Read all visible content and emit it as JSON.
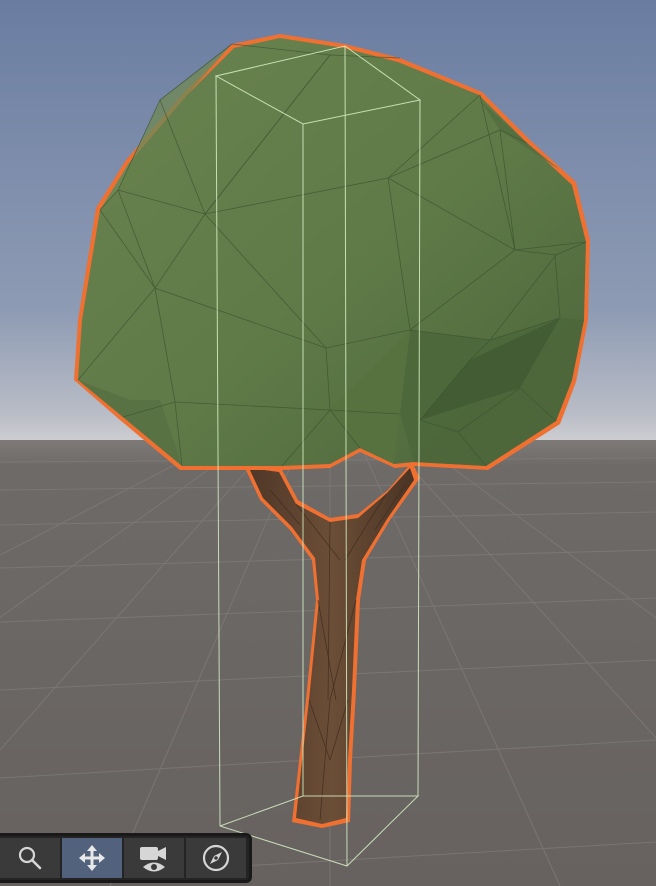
{
  "scene": {
    "sky_top_color": "#6a7da1",
    "sky_horizon_color": "#c7c9cf",
    "ground_color": "#6e6b69",
    "grid_line_color": "#7f7c79",
    "selected_object": {
      "kind": "tree",
      "outline_color": "#f07032",
      "canopy_color": "#5f7a47",
      "trunk_color": "#5a4130",
      "bounds_color": "#d8f1c6"
    }
  },
  "toolbar": {
    "tools": [
      {
        "name": "search-tool",
        "icon": "magnifier-icon",
        "active": false
      },
      {
        "name": "move-tool",
        "icon": "move-arrows-icon",
        "active": true
      },
      {
        "name": "camera-view-tool",
        "icon": "camera-eye-icon",
        "active": false
      },
      {
        "name": "orientation-tool",
        "icon": "compass-icon",
        "active": false
      }
    ],
    "active_color": "#52627c"
  }
}
